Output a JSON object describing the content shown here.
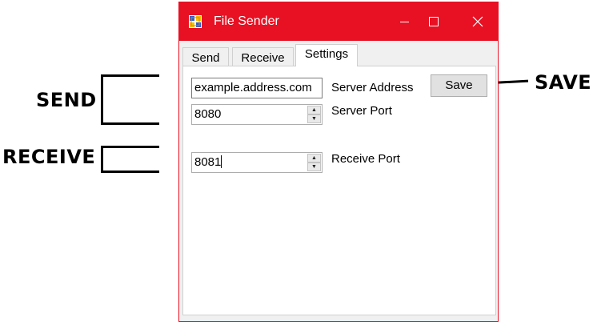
{
  "window": {
    "title": "File Sender",
    "accent_color": "#e81123",
    "icons": {
      "app": "file-sender-app-icon",
      "minimize": "minimize-icon",
      "maximize": "maximize-icon",
      "close": "close-icon"
    }
  },
  "tabs": [
    {
      "label": "Send",
      "active": false
    },
    {
      "label": "Receive",
      "active": false
    },
    {
      "label": "Settings",
      "active": true
    }
  ],
  "settings": {
    "server_address": {
      "value": "example.address.com",
      "label": "Server Address"
    },
    "server_port": {
      "value": "8080",
      "label": "Server Port"
    },
    "receive_port": {
      "value": "8081",
      "label": "Receive Port"
    },
    "save_label": "Save"
  },
  "annotations": {
    "send": "SEND",
    "receive": "RECEIVE",
    "save": "SAVE"
  }
}
